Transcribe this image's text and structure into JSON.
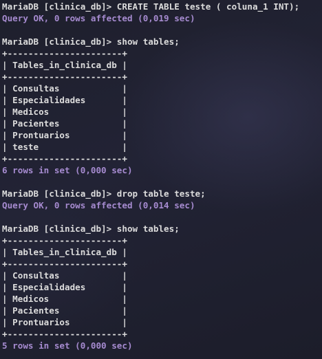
{
  "terminal": {
    "lines": [
      {
        "kind": "cmd",
        "text": "MariaDB [clinica_db]> CREATE TABLE teste ( coluna_1 INT);"
      },
      {
        "kind": "status",
        "text": "Query OK, 0 rows affected (0,019 sec)"
      },
      {
        "kind": "blank",
        "text": ""
      },
      {
        "kind": "cmd",
        "text": "MariaDB [clinica_db]> show tables;"
      },
      {
        "kind": "border",
        "text": "+----------------------+"
      },
      {
        "kind": "header",
        "text": "| Tables_in_clinica_db |"
      },
      {
        "kind": "border",
        "text": "+----------------------+"
      },
      {
        "kind": "row",
        "text": "| Consultas            |"
      },
      {
        "kind": "row",
        "text": "| Especialidades       |"
      },
      {
        "kind": "row",
        "text": "| Medicos              |"
      },
      {
        "kind": "row",
        "text": "| Pacientes            |"
      },
      {
        "kind": "row",
        "text": "| Prontuarios          |"
      },
      {
        "kind": "row",
        "text": "| teste                |"
      },
      {
        "kind": "border",
        "text": "+----------------------+"
      },
      {
        "kind": "status",
        "text": "6 rows in set (0,000 sec)"
      },
      {
        "kind": "blank",
        "text": ""
      },
      {
        "kind": "cmd",
        "text": "MariaDB [clinica_db]> drop table teste;"
      },
      {
        "kind": "status",
        "text": "Query OK, 0 rows affected (0,014 sec)"
      },
      {
        "kind": "blank",
        "text": ""
      },
      {
        "kind": "cmd",
        "text": "MariaDB [clinica_db]> show tables;"
      },
      {
        "kind": "border",
        "text": "+----------------------+"
      },
      {
        "kind": "header",
        "text": "| Tables_in_clinica_db |"
      },
      {
        "kind": "border",
        "text": "+----------------------+"
      },
      {
        "kind": "row",
        "text": "| Consultas            |"
      },
      {
        "kind": "row",
        "text": "| Especialidades       |"
      },
      {
        "kind": "row",
        "text": "| Medicos              |"
      },
      {
        "kind": "row",
        "text": "| Pacientes            |"
      },
      {
        "kind": "row",
        "text": "| Prontuarios          |"
      },
      {
        "kind": "border",
        "text": "+----------------------+"
      },
      {
        "kind": "status",
        "text": "5 rows in set (0,000 sec)"
      }
    ]
  },
  "colors": {
    "background": "#1b1c28",
    "text": "#dcdcdc",
    "status": "#a68bd0"
  }
}
